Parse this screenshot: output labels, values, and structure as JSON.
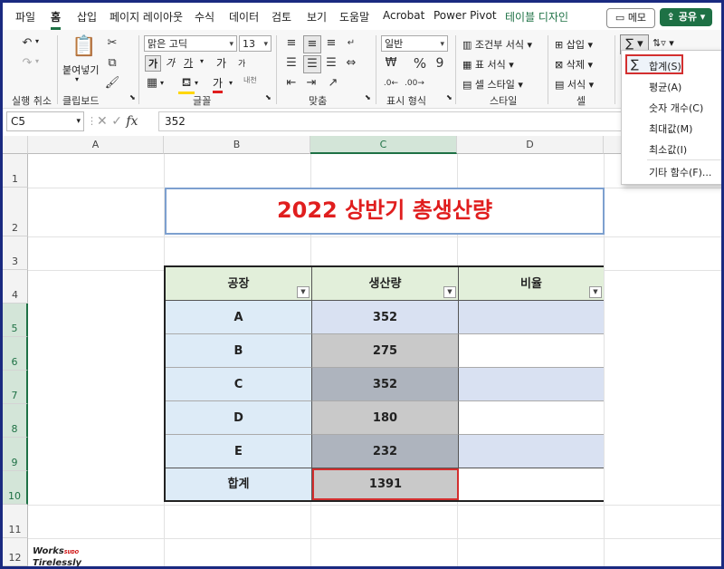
{
  "menu": {
    "tabs": [
      "파일",
      "홈",
      "삽입",
      "페이지 레이아웃",
      "수식",
      "데이터",
      "검토",
      "보기",
      "도움말",
      "Acrobat",
      "Power Pivot",
      "테이블 디자인"
    ],
    "memo": "메모",
    "share": "공유"
  },
  "ribbon": {
    "undo_group": "실행 취소",
    "clipboard_group": "클립보드",
    "paste": "붙여넣기",
    "font_name": "맑은 고딕",
    "font_size": "13",
    "font_group": "글꼴",
    "align_group": "맞춤",
    "number_format": "일반",
    "number_group": "표시 형식",
    "cond_format": "조건부 서식",
    "table_format": "표 서식",
    "cell_style": "셀 스타일",
    "style_group": "스타일",
    "insert": "삽입",
    "delete": "삭제",
    "format": "서식",
    "cells_group": "셀",
    "bold": "가",
    "italic": "가",
    "font_color_glyph": "가",
    "bigger": "가",
    "smaller": "가",
    "phonetic": "내천"
  },
  "formula_bar": {
    "name_box": "C5",
    "fx": "fx",
    "value": "352"
  },
  "columns": [
    "A",
    "B",
    "C",
    "D"
  ],
  "rows": [
    "1",
    "2",
    "3",
    "4",
    "5",
    "6",
    "7",
    "8",
    "9",
    "10",
    "11",
    "12"
  ],
  "sheet": {
    "title": "2022 상반기 총생산량",
    "headers": [
      "공장",
      "생산량",
      "비율"
    ],
    "rows": [
      {
        "factory": "A",
        "qty": "352"
      },
      {
        "factory": "B",
        "qty": "275"
      },
      {
        "factory": "C",
        "qty": "352"
      },
      {
        "factory": "D",
        "qty": "180"
      },
      {
        "factory": "E",
        "qty": "232"
      }
    ],
    "total_label": "합계",
    "total_value": "1391"
  },
  "autosum_menu": {
    "items": [
      "합계(S)",
      "평균(A)",
      "숫자 개수(C)",
      "최대값(M)",
      "최소값(I)",
      "기타 함수(F)..."
    ]
  },
  "watermark": {
    "line1": "Works",
    "line1_small": "SUDO",
    "line2": "Tirelessly"
  },
  "colors": {
    "accent": "#1e7145",
    "title_red": "#e01e1e",
    "header_fill": "#e2efda",
    "factory_fill": "#ddebf7",
    "qty_fill": "#c9c9c9",
    "band_fill": "#d9e1f2",
    "highlight_red": "#d32f2f"
  }
}
